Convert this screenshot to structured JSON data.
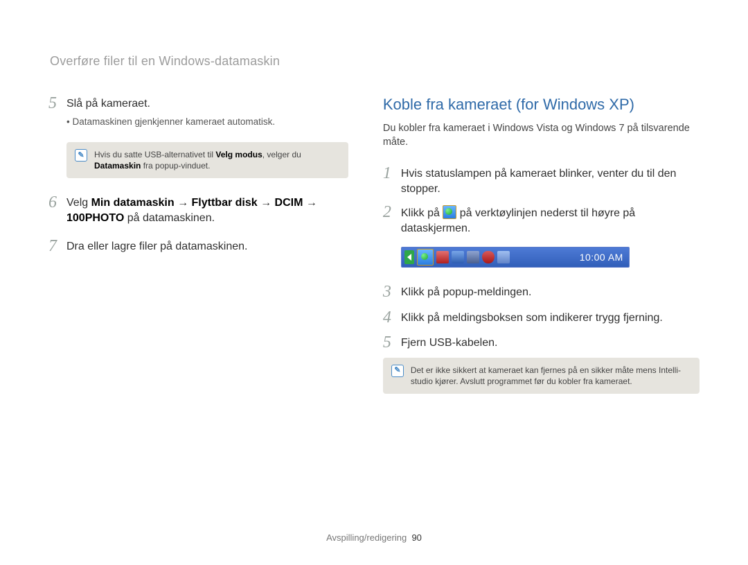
{
  "heading": "Overføre filer til en Windows-datamaskin",
  "left": {
    "step5": {
      "num": "5",
      "title": "Slå på kameraet.",
      "bullet": "Datamaskinen gjenkjenner kameraet automatisk."
    },
    "note1_pre": "Hvis du satte USB-alternativet til ",
    "note1_b1": "Velg modus",
    "note1_mid": ", velger du ",
    "note1_b2": "Datamaskin",
    "note1_post": " fra popup-vinduet.",
    "step6": {
      "num": "6",
      "pre": "Velg ",
      "b1": "Min datamaskin",
      "arrow": " → ",
      "b2": "Flyttbar disk",
      "b3": "DCIM",
      "b4": "100PHOTO",
      "post": " på datamaskinen."
    },
    "step7": {
      "num": "7",
      "text": "Dra eller lagre filer på datamaskinen."
    }
  },
  "right": {
    "title": "Koble fra kameraet (for Windows XP)",
    "sub": "Du kobler fra kameraet i Windows Vista og Windows 7 på tilsvarende måte.",
    "step1": {
      "num": "1",
      "text": "Hvis statuslampen på kameraet blinker, venter du til den stopper."
    },
    "step2": {
      "num": "2",
      "pre": "Klikk på ",
      "post": " på verktøylinjen nederst til høyre på dataskjermen."
    },
    "tray_time": "10:00 AM",
    "step3": {
      "num": "3",
      "text": "Klikk på popup-meldingen."
    },
    "step4": {
      "num": "4",
      "text": "Klikk på meldingsboksen som indikerer trygg fjerning."
    },
    "step5": {
      "num": "5",
      "text": "Fjern USB-kabelen."
    },
    "note2": "Det er ikke sikkert at kameraet kan fjernes på en sikker måte mens Intelli-studio kjører. Avslutt programmet før du kobler fra kameraet."
  },
  "footer": {
    "section": "Avspilling/redigering",
    "page": "90"
  }
}
